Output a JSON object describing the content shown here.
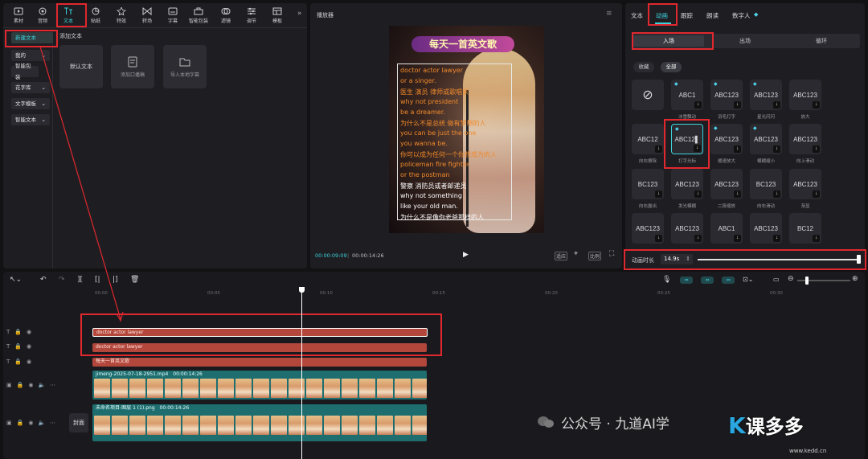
{
  "toolbar": {
    "items": [
      {
        "label": "素材",
        "icon": "media-icon"
      },
      {
        "label": "音频",
        "icon": "audio-icon"
      },
      {
        "label": "文本",
        "icon": "text-icon",
        "active": true
      },
      {
        "label": "贴纸",
        "icon": "sticker-icon"
      },
      {
        "label": "特效",
        "icon": "effects-icon"
      },
      {
        "label": "转场",
        "icon": "transition-icon"
      },
      {
        "label": "字幕",
        "icon": "subtitle-icon"
      },
      {
        "label": "智能包装",
        "icon": "smart-package-icon"
      },
      {
        "label": "滤镜",
        "icon": "filter-icon"
      },
      {
        "label": "调节",
        "icon": "adjust-icon"
      },
      {
        "label": "模板",
        "icon": "template-icon"
      }
    ],
    "more": "»"
  },
  "text_sidebar": {
    "items": [
      "新建文本",
      "我的",
      "智能包装",
      "花字库",
      "文字模板",
      "智能文本"
    ]
  },
  "text_panel": {
    "title": "添加文本",
    "cards": [
      "默认文本",
      "添加口播稿",
      "导入本地字幕"
    ]
  },
  "player": {
    "title": "播放器",
    "banner": "每天一首英文歌",
    "lyrics": [
      {
        "text": "doctor actor lawyer",
        "color": "#f08a2c"
      },
      {
        "text": "or a singer.",
        "color": "#f08a2c"
      },
      {
        "text": "医生 演员 律师或歌唱家",
        "color": "#f08a2c"
      },
      {
        "text": "why not president",
        "color": "#f08a2c"
      },
      {
        "text": "be a dreamer.",
        "color": "#f08a2c"
      },
      {
        "text": "为什么不是总统 做有梦想的人",
        "color": "#f08a2c"
      },
      {
        "text": "you can be just the one",
        "color": "#f08a2c"
      },
      {
        "text": "you wanna be.",
        "color": "#f08a2c"
      },
      {
        "text": "你可以成为任何一个你想成为的人",
        "color": "#f08a2c"
      },
      {
        "text": "policeman fire fighter",
        "color": "#f08a2c"
      },
      {
        "text": "or the postman",
        "color": "#f08a2c"
      },
      {
        "text": "警察 消防员或者邮递员",
        "color": "#ffffff"
      },
      {
        "text": "why not something",
        "color": "#ffffff"
      },
      {
        "text": "like your old man.",
        "color": "#ffffff"
      },
      {
        "text": "为什么不是像你老爸那样的人",
        "color": "#ffffff"
      }
    ],
    "current_time": "00:00:09:09",
    "total_time": "00:00:14:26",
    "btn_ratio": "适应",
    "btn_original": "比例"
  },
  "right_panel": {
    "tabs": [
      {
        "label": "文本"
      },
      {
        "label": "动画",
        "active": true
      },
      {
        "label": "跟踪"
      },
      {
        "label": "朗读"
      },
      {
        "label": "数字人"
      }
    ],
    "subtabs": [
      "入场",
      "出场",
      "循环"
    ],
    "filters": [
      "收藏",
      "全部"
    ],
    "animations": [
      {
        "preview": "⊘",
        "label": ""
      },
      {
        "preview": "ABC1",
        "label": "冰雪飘动",
        "vip": true
      },
      {
        "preview": "ABC123",
        "label": "羽毛打字",
        "vip": true
      },
      {
        "preview": "ABC123",
        "label": "星光闪闪",
        "vip": true
      },
      {
        "preview": "ABC123",
        "label": "放大"
      },
      {
        "preview": "ABC12",
        "label": "向右擦除"
      },
      {
        "preview": "ABC12▌",
        "label": "打字光标",
        "vip": true
      },
      {
        "preview": "ABC123",
        "label": "缓速放大",
        "vip": true
      },
      {
        "preview": "ABC123",
        "label": "模糊缩小",
        "vip": true
      },
      {
        "preview": "ABC123",
        "label": "向上滑动"
      },
      {
        "preview": "BC123",
        "label": "向右露出"
      },
      {
        "preview": "ABC123",
        "label": "发光模糊"
      },
      {
        "preview": "ABC123",
        "label": "二段缩放"
      },
      {
        "preview": "BC123",
        "label": "向右滑动"
      },
      {
        "preview": "ABC123",
        "label": "渐显"
      },
      {
        "preview": "ABC123",
        "label": ""
      },
      {
        "preview": "ABC123",
        "label": ""
      },
      {
        "preview": "ABC1",
        "label": ""
      },
      {
        "preview": "ABC123",
        "label": ""
      },
      {
        "preview": "BC12",
        "label": ""
      }
    ],
    "duration_label": "动画时长",
    "duration_value": "14.9s"
  },
  "timeline": {
    "ruler": [
      "00:00",
      "00:05",
      "00:10",
      "00:15",
      "00:20",
      "00:25",
      "00:30"
    ],
    "tracks": [
      {
        "name": "doctor actor lawyer",
        "type": "text"
      },
      {
        "name": "doctor actor lawyer",
        "type": "text"
      },
      {
        "name": "每天一首英文歌",
        "type": "text"
      },
      {
        "name": "jimeng-2025-07-18-2951.mp4",
        "duration": "00:00:14:26",
        "type": "video"
      },
      {
        "name": "未命名项目-图层 1 (1).png",
        "duration": "00:00:14:26",
        "type": "image"
      }
    ],
    "cover_label": "封面"
  },
  "watermark": {
    "text": "公众号 · 九道AI学",
    "logo": "课多多",
    "url": "www.kedd.cn"
  },
  "colors": {
    "accent": "#3dd1dc",
    "highlight": "#e0282e",
    "text_clip": "#b4473c",
    "video_clip": "#1e6e70"
  }
}
